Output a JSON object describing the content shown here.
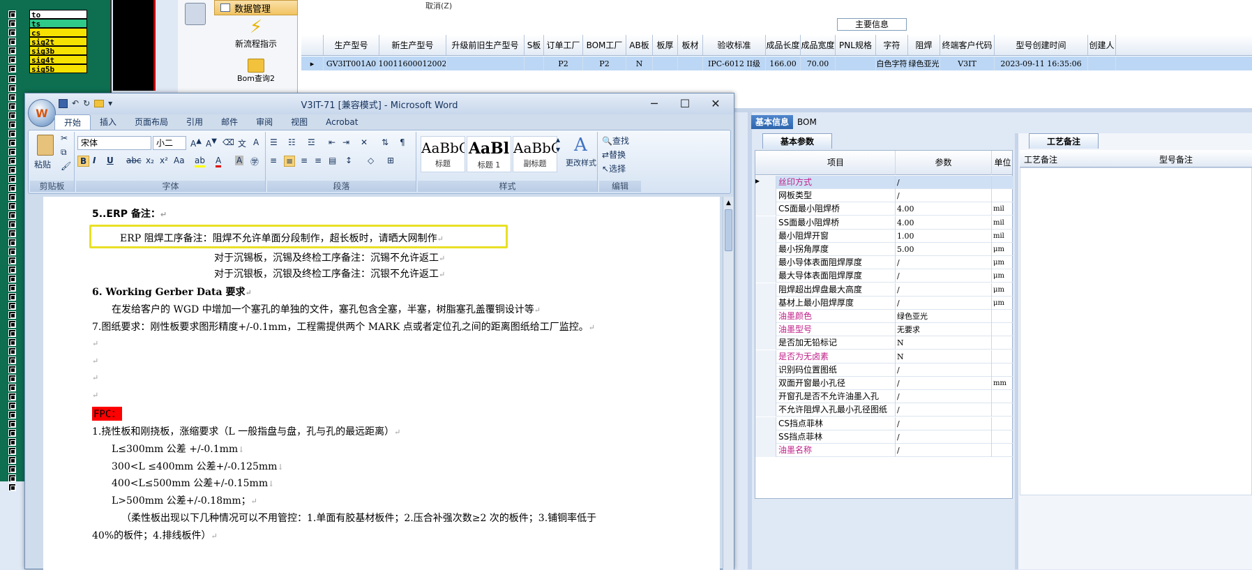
{
  "layers": {
    "names": [
      "to",
      "ts",
      "cs",
      "sig2t",
      "sig3b",
      "sig4t",
      "sig5b"
    ],
    "name_colors": [
      "#ffffff",
      "#2fc98a",
      "#f6e200",
      "#f6e200",
      "#f6e200",
      "#f6e200",
      "#f6e200"
    ]
  },
  "erp": {
    "nav_header": "数据管理",
    "nav_item_1": "新流程指示",
    "nav_item_2": "Bom查询2",
    "cancel_label": "取消(Z)",
    "main_info_label": "主要信息",
    "grid_columns": [
      "生产型号",
      "新生产型号",
      "升级前旧生产型号",
      "S板",
      "订单工厂",
      "BOM工厂",
      "AB板",
      "板厚",
      "板材",
      "验收标准",
      "成品长度",
      "成品宽度",
      "PNL规格",
      "字符",
      "阻焊",
      "终端客户代码",
      "型号创建时间",
      "创建人"
    ],
    "grid_row": [
      "GV3IT001A0",
      "10011600012002",
      "",
      "",
      "P2",
      "P2",
      "N",
      "",
      "",
      "IPC-6012 II级",
      "166.00",
      "70.00",
      "",
      "白色字符",
      "绿色亚光",
      "V3IT",
      "2023-09-11 16:35:06",
      ""
    ],
    "right_tabs": [
      "基本信息",
      "BOM"
    ],
    "param_tab": "基本参数",
    "param_columns": [
      "项目",
      "参数",
      "单位"
    ],
    "params": [
      {
        "k": "丝印方式",
        "v": "/",
        "u": "",
        "hl": true
      },
      {
        "k": "网板类型",
        "v": "/",
        "u": "",
        "hl": false
      },
      {
        "k": "CS面最小阻焊桥",
        "v": "4.00",
        "u": "mil",
        "hl": false
      },
      {
        "k": "SS面最小阻焊桥",
        "v": "4.00",
        "u": "mil",
        "hl": false
      },
      {
        "k": "最小阻焊开窗",
        "v": "1.00",
        "u": "mil",
        "hl": false
      },
      {
        "k": "最小拐角厚度",
        "v": "5.00",
        "u": "μm",
        "hl": false
      },
      {
        "k": "最小导体表面阻焊厚度",
        "v": "/",
        "u": "μm",
        "hl": false
      },
      {
        "k": "最大导体表面阻焊厚度",
        "v": "/",
        "u": "μm",
        "hl": false
      },
      {
        "k": "阻焊超出焊盘最大高度",
        "v": "/",
        "u": "μm",
        "hl": false
      },
      {
        "k": "基材上最小阻焊厚度",
        "v": "/",
        "u": "μm",
        "hl": false
      },
      {
        "k": "油墨颜色",
        "v": "绿色亚光",
        "u": "",
        "hl": true
      },
      {
        "k": "油墨型号",
        "v": "无要求",
        "u": "",
        "hl": true
      },
      {
        "k": "是否加无铅标记",
        "v": "N",
        "u": "",
        "hl": false
      },
      {
        "k": "是否为无卤素",
        "v": "N",
        "u": "",
        "hl": true
      },
      {
        "k": "识别码位置图纸",
        "v": "/",
        "u": "",
        "hl": false
      },
      {
        "k": "双面开窗最小孔径",
        "v": "/",
        "u": "mm",
        "hl": false
      },
      {
        "k": "开窗孔是否不允许油墨入孔",
        "v": "/",
        "u": "",
        "hl": false
      },
      {
        "k": "不允许阻焊入孔最小孔径图纸",
        "v": "/",
        "u": "",
        "hl": false
      },
      {
        "k": "CS挡点菲林",
        "v": "/",
        "u": "",
        "hl": false
      },
      {
        "k": "SS挡点菲林",
        "v": "/",
        "u": "",
        "hl": false
      },
      {
        "k": "油墨名称",
        "v": "/",
        "u": "",
        "hl": true
      }
    ],
    "notes_tab": "工艺备注",
    "notes_columns": [
      "工艺备注",
      "型号备注"
    ]
  },
  "word": {
    "title": "V3IT-71 [兼容模式] - Microsoft Word",
    "tabs": [
      "开始",
      "插入",
      "页面布局",
      "引用",
      "邮件",
      "审阅",
      "视图",
      "Acrobat"
    ],
    "font_name": "宋体",
    "font_size": "小二",
    "paste_label": "粘贴",
    "groups": [
      "剪贴板",
      "字体",
      "段落",
      "样式",
      "编辑"
    ],
    "styles": [
      {
        "sample": "AaBbC",
        "label": "标题"
      },
      {
        "sample": "AaBl",
        "label": "标题 1"
      },
      {
        "sample": "AaBbC",
        "label": "副标题"
      }
    ],
    "change_styles": "更改样式",
    "edit_find": "查找",
    "edit_replace": "替换",
    "edit_select": "选择",
    "doc": {
      "l1": "5..ERP 备注：",
      "l2": "ERP 阻焊工序备注：阻焊不允许单面分段制作，超长板时，请晒大网制作",
      "l3": "对于沉锡板，沉锡及终检工序备注：沉锡不允许返工",
      "l4": "对于沉银板，沉银及终检工序备注：沉银不允许返工",
      "l5": "6. Working Gerber Data 要求",
      "l6": "在发给客户的 WGD 中增加一个塞孔的单独的文件，塞孔包含全塞，半塞，树脂塞孔盖覆铜设计等",
      "l7": "7.图纸要求：刚性板要求图形精度+/-0.1mm，工程需提供两个 MARK 点或者定位孔之间的距离图纸给工厂监控。",
      "fpc": "FPC：",
      "l8": "1.挠性板和刚挠板，涨缩要求（L 一般指盘与盘，孔与孔的最远距离）",
      "l9": "L≤300mm 公差 +/-0.1mm",
      "l10": "300<L ≤400mm 公差+/-0.125mm",
      "l11": "400<L≤500mm 公差+/-0.15mm",
      "l12": "L>500mm 公差+/-0.18mm；",
      "l13": "（柔性板出现以下几种情况可以不用管控：1.单面有胶基材板件；2.压合补强次数≥2 次的板件；3.铺铜率低于",
      "l14": "40%的板件；4.排线板件）"
    }
  },
  "colors": {
    "highlight_border": "#e8e025",
    "pink_label": "#c0208a",
    "fpc_bg": "#ff0000"
  }
}
